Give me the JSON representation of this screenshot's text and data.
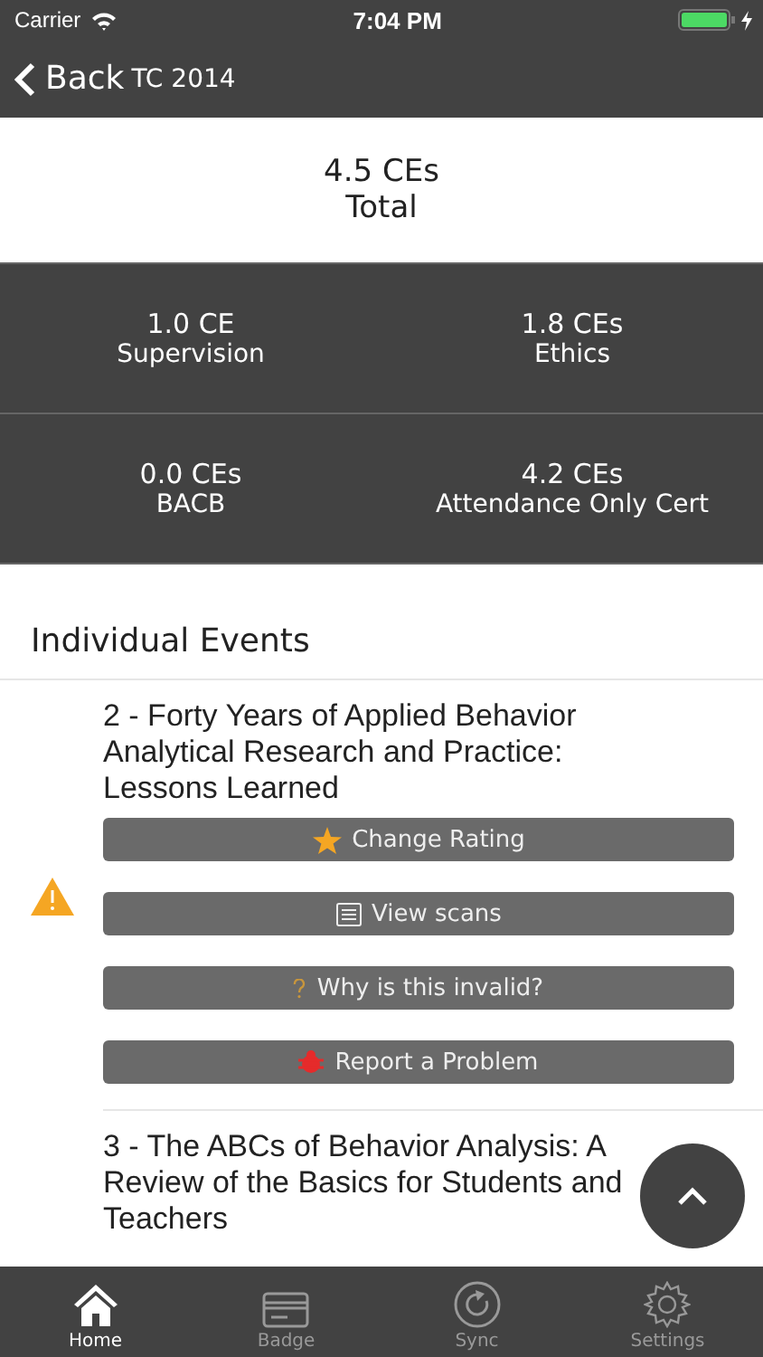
{
  "status_bar": {
    "carrier": "Carrier",
    "time": "7:04 PM"
  },
  "nav": {
    "back": "Back",
    "title": "TC 2014"
  },
  "total": {
    "value": "4.5 CEs",
    "label": "Total"
  },
  "categories": [
    {
      "value": "1.0 CE",
      "label": "Supervision"
    },
    {
      "value": "1.8 CEs",
      "label": "Ethics"
    },
    {
      "value": "0.0 CEs",
      "label": "BACB"
    },
    {
      "value": "4.2 CEs",
      "label": "Attendance Only Cert"
    }
  ],
  "section_title": "Individual Events",
  "events": [
    {
      "title": "2 - Forty Years of Applied Behavior Analytical Research and Practice: Lessons Learned",
      "warning": true,
      "actions": [
        {
          "kind": "rating",
          "label": "Change Rating"
        },
        {
          "kind": "scans",
          "label": "View scans"
        },
        {
          "kind": "invalid",
          "label": "Why is this invalid?"
        },
        {
          "kind": "report",
          "label": "Report a Problem"
        }
      ]
    },
    {
      "title": "3 - The ABCs of Behavior Analysis: A Review of the Basics for Students and Teachers",
      "warning": false
    }
  ],
  "tabs": [
    {
      "kind": "home",
      "label": "Home",
      "selected": true
    },
    {
      "kind": "badge",
      "label": "Badge",
      "selected": false
    },
    {
      "kind": "sync",
      "label": "Sync",
      "selected": false
    },
    {
      "kind": "settings",
      "label": "Settings",
      "selected": false
    }
  ]
}
